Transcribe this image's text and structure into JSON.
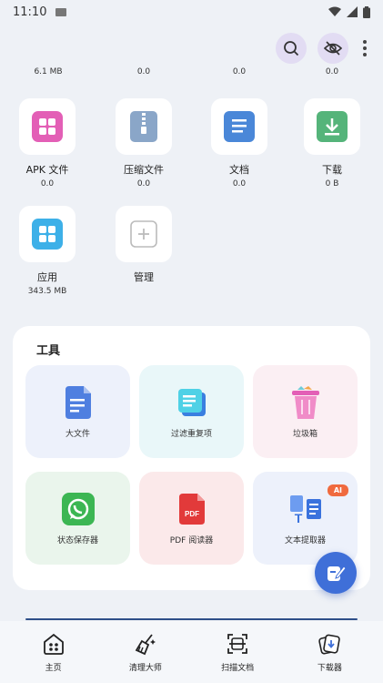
{
  "status": {
    "time": "11:10"
  },
  "header": {
    "search_icon": "search-icon",
    "hide_icon": "eye-off-icon",
    "more_icon": "more-vertical-icon"
  },
  "top_sizes": [
    "6.1 MB",
    "0.0",
    "0.0",
    "0.0"
  ],
  "categories": [
    {
      "label": "APK 文件",
      "value": "0.0",
      "icon": "apk-icon",
      "color": "#e35fb6"
    },
    {
      "label": "压缩文件",
      "value": "0.0",
      "icon": "zip-icon",
      "color": "#8aa6c8"
    },
    {
      "label": "文档",
      "value": "0.0",
      "icon": "document-icon",
      "color": "#4a87d8"
    },
    {
      "label": "下载",
      "value": "0 B",
      "icon": "download-icon",
      "color": "#55b47a"
    },
    {
      "label": "应用",
      "value": "343.5 MB",
      "icon": "apps-icon",
      "color": "#3db0e8"
    },
    {
      "label": "管理",
      "value": "",
      "icon": "plus-icon",
      "color": "#bbbbbb"
    }
  ],
  "tools": {
    "title": "工具",
    "items": [
      {
        "label": "大文件",
        "icon": "large-file-icon",
        "bg": "#edf1fb"
      },
      {
        "label": "过滤重复项",
        "icon": "duplicate-icon",
        "bg": "#e9f7f9"
      },
      {
        "label": "垃圾箱",
        "icon": "trash-icon",
        "bg": "#fbeff3"
      },
      {
        "label": "状态保存器",
        "icon": "whatsapp-icon",
        "bg": "#eaf5ec"
      },
      {
        "label": "PDF 阅读器",
        "icon": "pdf-icon",
        "bg": "#fbe9ea"
      },
      {
        "label": "文本提取器",
        "icon": "text-extract-icon",
        "bg": "#edf1fb",
        "badge": "AI"
      }
    ]
  },
  "nav": [
    {
      "label": "主页",
      "icon": "home-icon"
    },
    {
      "label": "清理大师",
      "icon": "broom-icon"
    },
    {
      "label": "扫描文档",
      "icon": "scan-icon"
    },
    {
      "label": "下载器",
      "icon": "downloader-icon"
    }
  ],
  "colors": {
    "accent": "#3f6fd8",
    "background": "#eef1f6",
    "badge": "#f06a3e"
  }
}
